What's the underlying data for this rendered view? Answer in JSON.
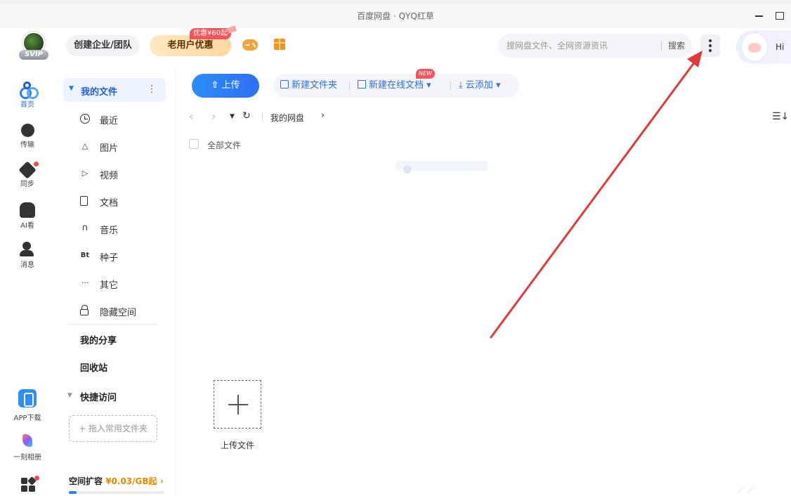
{
  "window": {
    "title": "百度网盘 · QYQ红草"
  },
  "header": {
    "avatar_badge": "SVIP",
    "enterprise_button": "创建企业/团队",
    "old_user_button": "老用户优惠",
    "promo_tag": "优惠¥60起",
    "search_placeholder": "搜网盘文件、全网资源资讯",
    "search_button": "搜索",
    "hi_label": "Hi"
  },
  "left_nav": {
    "items": [
      {
        "label": "首页",
        "icon": "cloud-home-icon"
      },
      {
        "label": "传输",
        "icon": "transfer-icon"
      },
      {
        "label": "同步",
        "icon": "sync-icon"
      },
      {
        "label": "AI看",
        "icon": "ai-icon"
      },
      {
        "label": "消息",
        "icon": "message-icon"
      }
    ],
    "bottom_items": [
      {
        "label": "APP下载",
        "icon": "phone-icon"
      },
      {
        "label": "一刻相册",
        "icon": "album-icon"
      }
    ]
  },
  "sidebar": {
    "my_files": "我的文件",
    "items": [
      {
        "label": "最近",
        "icon": "clock-icon"
      },
      {
        "label": "图片",
        "icon": "image-icon"
      },
      {
        "label": "视频",
        "icon": "play-icon"
      },
      {
        "label": "文档",
        "icon": "document-icon"
      },
      {
        "label": "音乐",
        "icon": "headphones-icon"
      },
      {
        "label": "种子",
        "icon": "torrent-icon",
        "glyph": "Bt"
      },
      {
        "label": "其它",
        "icon": "more-icon",
        "glyph": "···"
      },
      {
        "label": "隐藏空间",
        "icon": "lock-icon"
      }
    ],
    "my_share": "我的分享",
    "recycle_bin": "回收站",
    "quick_access": "快捷访问",
    "drop_zone": "+ 拖入常用文件夹",
    "space_expand": "空间扩容",
    "space_price": "¥0.03/GB起",
    "space_progress": 0.08
  },
  "toolbar": {
    "upload": "上传",
    "new_folder": "新建文件夹",
    "new_online_doc": "新建在线文档",
    "new_badge": "NEW",
    "cloud_add": "云添加"
  },
  "breadcrumb": {
    "root": "我的网盘"
  },
  "file_list": {
    "select_all_label": "全部文件",
    "upload_tile_label": "上传文件"
  },
  "colors": {
    "accent": "#2f7cf6",
    "annotation_arrow": "#e03a3a"
  }
}
